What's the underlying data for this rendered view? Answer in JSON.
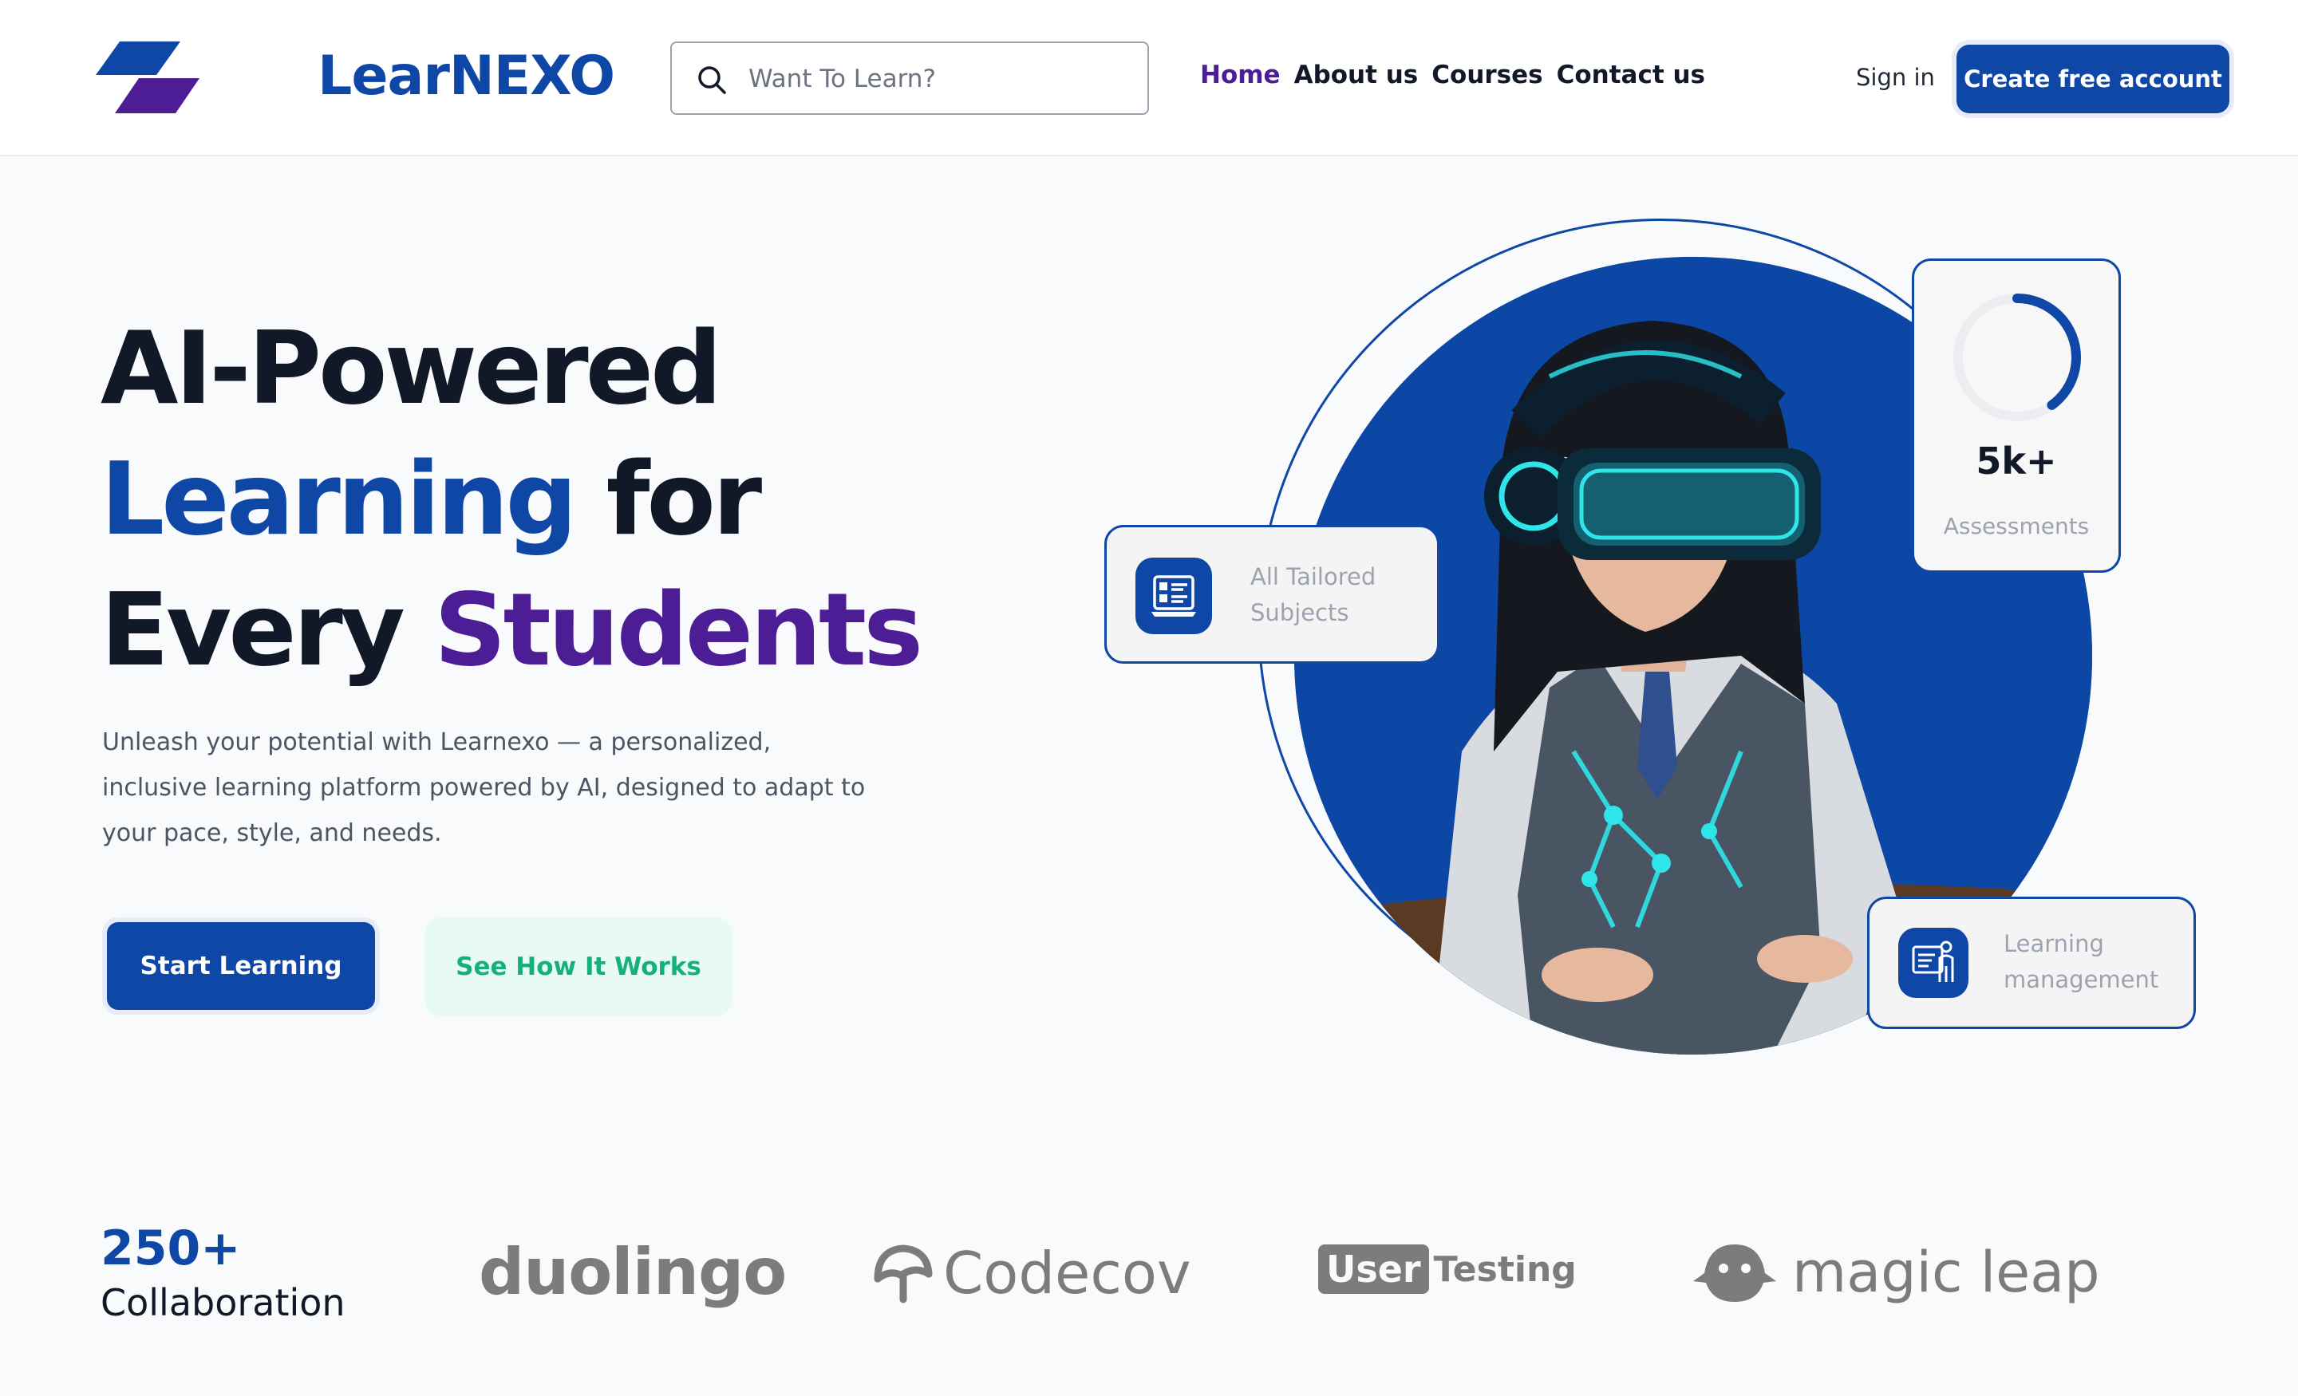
{
  "header": {
    "brand": "LearNEXO",
    "search_placeholder": "Want To Learn?",
    "nav": [
      "Home",
      "About us",
      "Courses",
      "Contact us"
    ],
    "active_nav": "Home",
    "signin": "Sign in",
    "cta": "Create free account"
  },
  "hero": {
    "title_line1": "AI-Powered",
    "title_line2_blue": "Learning",
    "title_line2_rest": " for",
    "title_line3_dark": "Every ",
    "title_line3_purple": "Students",
    "description": "Unleash your potential with Learnexo — a personalized, inclusive learning platform powered by AI, designed to adapt to your pace, style, and needs.",
    "primary_button": "Start Learning",
    "secondary_button": "See How It Works"
  },
  "cards": {
    "subjects": "All Tailored Subjects",
    "assessments_value": "5k+",
    "assessments_label": "Assessments",
    "assessments_progress": 0.4,
    "lms": "Learning management"
  },
  "partners": {
    "count": "250+",
    "label": "Collaboration",
    "logos": [
      "duolingo",
      "Codecov",
      "User",
      "Testing",
      "magic leap"
    ]
  },
  "colors": {
    "primary": "#0f47a6",
    "purple": "#4c1d95",
    "mint": "#16b07a",
    "mint_bg": "#e7fbf3",
    "logo_gray": "#7c7c7c"
  },
  "icons": [
    "logo-mark",
    "search-icon",
    "course-list-icon",
    "learning-management-icon",
    "codecov-icon",
    "magic-leap-icon"
  ]
}
